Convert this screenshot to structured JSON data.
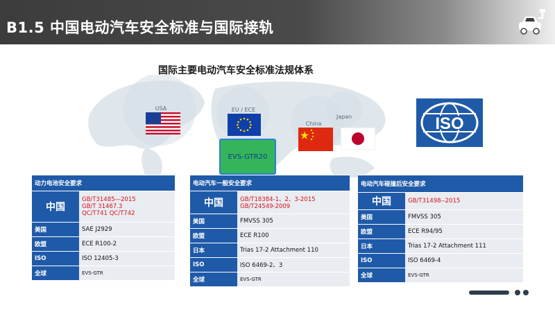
{
  "header": {
    "title": "B1.5  中国电动汽车安全标准与国际接轨"
  },
  "map": {
    "title": "国际主要电动汽车安全标准法规体系",
    "regions": [
      {
        "label": "USA"
      },
      {
        "label": "EU / ECE"
      },
      {
        "label": "China"
      },
      {
        "label": "Japan"
      }
    ],
    "evs_box": "EVS-GTR20",
    "iso_text": "ISO"
  },
  "tables": [
    {
      "title": "动力电池安全要求",
      "rows": [
        {
          "label": "中国",
          "lines": [
            "GB/T31485—2015",
            "GB/T 31467.3",
            "QC/T741  QC/T742"
          ],
          "red": true
        },
        {
          "label": "美国",
          "lines": [
            "SAE J2929"
          ]
        },
        {
          "label": "欧盟",
          "lines": [
            "ECE R100-2"
          ]
        },
        {
          "label": "ISO",
          "lines": [
            "ISO  12405-3"
          ]
        },
        {
          "label": "全球",
          "lines": [
            "EVS-GTR"
          ],
          "small": true
        }
      ]
    },
    {
      "title": "电动汽车一般安全要求",
      "rows": [
        {
          "label": "中国",
          "lines": [
            "GB/T18384-1、2、3-2015",
            "GB/T24549-2009"
          ],
          "red": true
        },
        {
          "label": "美国",
          "lines": [
            "FMVSS 305"
          ]
        },
        {
          "label": "欧盟",
          "lines": [
            "ECE R100"
          ]
        },
        {
          "label": "日本",
          "lines": [
            "Trias 17-2 Attachment 110"
          ]
        },
        {
          "label": "ISO",
          "lines": [
            "ISO  6469-2、3"
          ]
        },
        {
          "label": "全球",
          "lines": [
            "EVS-GTR"
          ],
          "small": true
        }
      ]
    },
    {
      "title": "电动汽车碰撞后安全要求",
      "rows": [
        {
          "label": "中国",
          "lines": [
            "GB/T31498--2015"
          ],
          "red": true
        },
        {
          "label": "美国",
          "lines": [
            "FMVSS 305"
          ]
        },
        {
          "label": "欧盟",
          "lines": [
            "ECE R94/95"
          ]
        },
        {
          "label": "日本",
          "lines": [
            "Trias 17-2 Attachment 111"
          ]
        },
        {
          "label": "ISO",
          "lines": [
            "ISO  6469-4"
          ]
        },
        {
          "label": "全球",
          "lines": [
            "EVS-GTR"
          ],
          "small": true
        }
      ]
    }
  ],
  "colors": {
    "accent_blue": "#1f5aa8",
    "red_text": "#d3131a",
    "evs_green": "#35b55a"
  }
}
